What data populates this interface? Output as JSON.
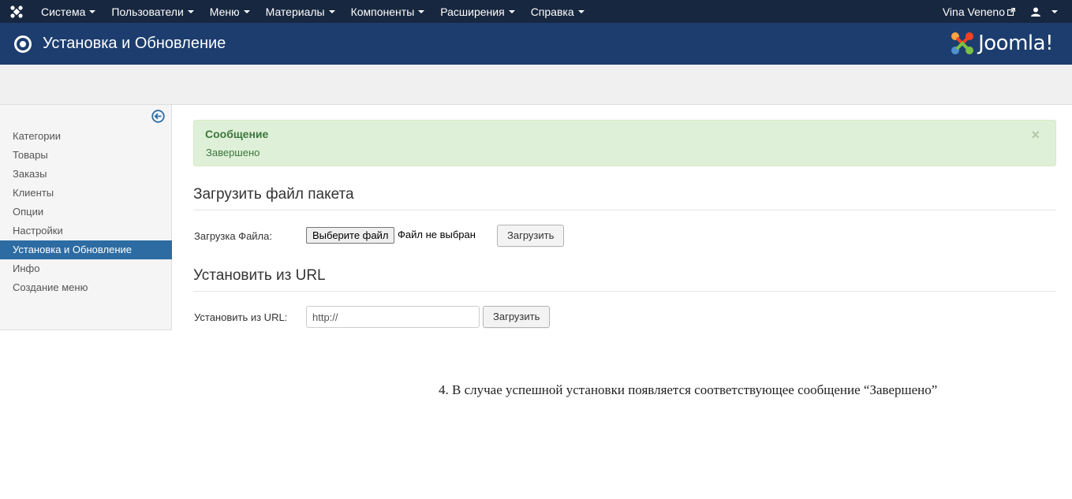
{
  "navbar": {
    "menu": [
      {
        "label": "Система"
      },
      {
        "label": "Пользователи"
      },
      {
        "label": "Меню"
      },
      {
        "label": "Материалы"
      },
      {
        "label": "Компоненты"
      },
      {
        "label": "Расширения"
      },
      {
        "label": "Справка"
      }
    ],
    "user_link": "Vina Veneno",
    "user_icon": "user-icon"
  },
  "header": {
    "title": "Установка и Обновление",
    "logo_text": "Joomla!"
  },
  "sidebar": {
    "items": [
      {
        "label": "Категории"
      },
      {
        "label": "Товары"
      },
      {
        "label": "Заказы"
      },
      {
        "label": "Клиенты"
      },
      {
        "label": "Опции"
      },
      {
        "label": "Настройки"
      },
      {
        "label": "Установка и Обновление",
        "active": true
      },
      {
        "label": "Инфо"
      },
      {
        "label": "Создание меню"
      }
    ]
  },
  "alert": {
    "heading": "Сообщение",
    "message": "Завершено",
    "close": "×"
  },
  "upload_section": {
    "title": "Загрузить файл пакета",
    "label": "Загрузка Файла:",
    "file_button": "Выберите файл",
    "file_status": "Файл не выбран",
    "submit": "Загрузить"
  },
  "url_section": {
    "title": "Установить из URL",
    "label": "Установить из URL:",
    "input_value": "http://",
    "submit": "Загрузить"
  },
  "note": "4. В случае успешной установки появляется соответствующее сообщение “Завершено”",
  "colors": {
    "navbar": "#17273f",
    "header": "#1c3d6e",
    "active_item": "#2d6ca2",
    "alert_bg": "#dff0d8",
    "alert_text": "#3c763d"
  }
}
